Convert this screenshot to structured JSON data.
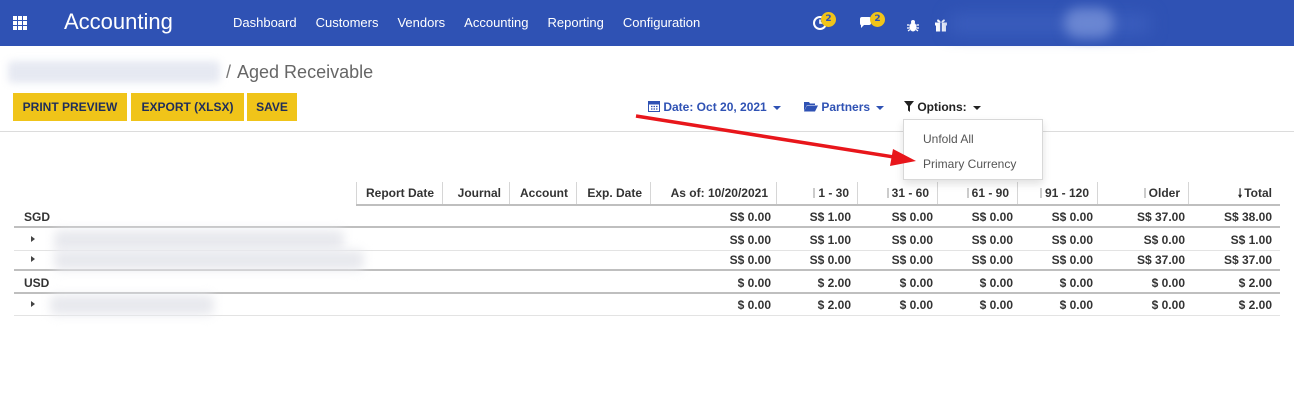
{
  "app": {
    "title": "Accounting"
  },
  "nav": {
    "items": [
      "Dashboard",
      "Customers",
      "Vendors",
      "Accounting",
      "Reporting",
      "Configuration"
    ],
    "activity_badge": "2",
    "messages_badge": "2"
  },
  "breadcrumb": {
    "separator": "/",
    "current": "Aged Receivable"
  },
  "buttons": {
    "print_preview": "PRINT PREVIEW",
    "export_xlsx": "EXPORT (XLSX)",
    "save": "SAVE"
  },
  "filters": {
    "date": "Date: Oct 20, 2021",
    "partners": "Partners",
    "options": "Options:"
  },
  "options_menu": {
    "items": [
      "Unfold All",
      "Primary Currency"
    ]
  },
  "table": {
    "columns": [
      "Report Date",
      "Journal",
      "Account",
      "Exp. Date",
      "As of: 10/20/2021",
      "1 - 30",
      "31 - 60",
      "61 - 90",
      "91 - 120",
      "Older",
      "Total"
    ],
    "rows": [
      {
        "type": "currency",
        "label": "SGD",
        "values": [
          "S$ 0.00",
          "S$ 1.00",
          "S$ 0.00",
          "S$ 0.00",
          "S$ 0.00",
          "S$ 37.00",
          "S$ 38.00"
        ]
      },
      {
        "type": "partner",
        "label": "",
        "values": [
          "S$ 0.00",
          "S$ 1.00",
          "S$ 0.00",
          "S$ 0.00",
          "S$ 0.00",
          "S$ 0.00",
          "S$ 1.00"
        ]
      },
      {
        "type": "partner",
        "label": "",
        "values": [
          "S$ 0.00",
          "S$ 0.00",
          "S$ 0.00",
          "S$ 0.00",
          "S$ 0.00",
          "S$ 37.00",
          "S$ 37.00"
        ]
      },
      {
        "type": "currency",
        "label": "USD",
        "values": [
          "$ 0.00",
          "$ 2.00",
          "$ 0.00",
          "$ 0.00",
          "$ 0.00",
          "$ 0.00",
          "$ 2.00"
        ]
      },
      {
        "type": "partner",
        "label": "",
        "values": [
          "$ 0.00",
          "$ 2.00",
          "$ 0.00",
          "$ 0.00",
          "$ 0.00",
          "$ 0.00",
          "$ 2.00"
        ]
      }
    ]
  },
  "colors": {
    "navbar": "#2f52b4",
    "button": "#f0c419",
    "link": "#2f52b4",
    "annotation_arrow": "#e8161b"
  }
}
